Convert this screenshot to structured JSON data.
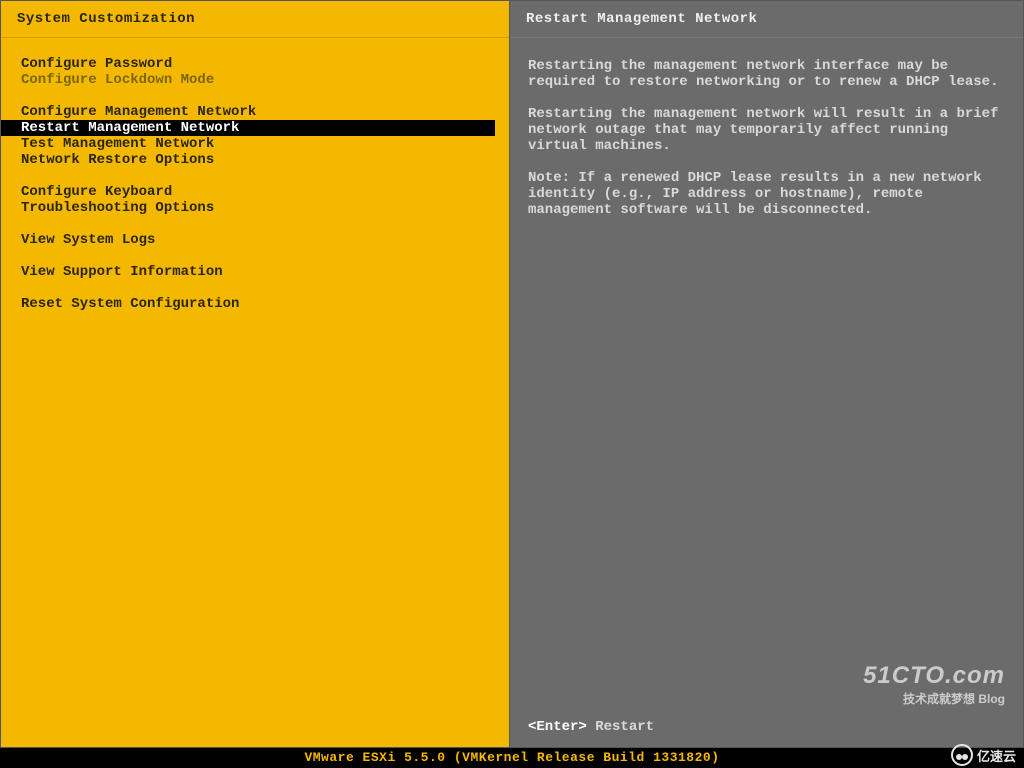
{
  "left": {
    "title": "System Customization",
    "groups": [
      [
        {
          "label": "Configure Password",
          "dimmed": false,
          "selected": false
        },
        {
          "label": "Configure Lockdown Mode",
          "dimmed": true,
          "selected": false
        }
      ],
      [
        {
          "label": "Configure Management Network",
          "dimmed": false,
          "selected": false
        },
        {
          "label": "Restart Management Network",
          "dimmed": false,
          "selected": true
        },
        {
          "label": "Test Management Network",
          "dimmed": false,
          "selected": false
        },
        {
          "label": "Network Restore Options",
          "dimmed": false,
          "selected": false
        }
      ],
      [
        {
          "label": "Configure Keyboard",
          "dimmed": false,
          "selected": false
        },
        {
          "label": "Troubleshooting Options",
          "dimmed": false,
          "selected": false
        }
      ],
      [
        {
          "label": "View System Logs",
          "dimmed": false,
          "selected": false
        }
      ],
      [
        {
          "label": "View Support Information",
          "dimmed": false,
          "selected": false
        }
      ],
      [
        {
          "label": "Reset System Configuration",
          "dimmed": false,
          "selected": false
        }
      ]
    ]
  },
  "right": {
    "title": "Restart Management Network",
    "paragraphs": [
      "Restarting the management network interface may be required to restore networking or to renew a DHCP lease.",
      "Restarting the management network will result in a brief network outage that may temporarily affect running virtual machines.",
      "Note: If a renewed DHCP lease results in a new network identity (e.g., IP address or hostname), remote management software will be disconnected."
    ],
    "hint_key": "<Enter>",
    "hint_action": "Restart"
  },
  "footer": "VMware ESXi 5.5.0 (VMKernel Release Build 1331820)",
  "watermark1_big": "51CTO.com",
  "watermark1_small": "技术成就梦想 Blog",
  "watermark2": "亿速云"
}
